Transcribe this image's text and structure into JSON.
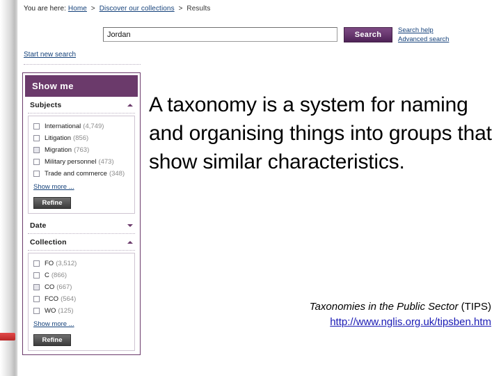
{
  "breadcrumb": {
    "prefix": "You are here:",
    "home": "Home",
    "separator": ">",
    "collections": "Discover our collections",
    "current": "Results"
  },
  "search": {
    "value": "Jordan",
    "placeholder": "",
    "button_label": "Search",
    "help_label": "Search help",
    "advanced_label": "Advanced search",
    "start_new_label": "Start new search"
  },
  "facets": {
    "header": "Show me",
    "subjects": {
      "title": "Subjects",
      "items": [
        {
          "label": "International",
          "count": "(4,749)"
        },
        {
          "label": "Litigation",
          "count": "(856)"
        },
        {
          "label": "Migration",
          "count": "(763)"
        },
        {
          "label": "Military personnel",
          "count": "(473)"
        },
        {
          "label": "Trade and commerce",
          "count": "(348)"
        }
      ],
      "show_more": "Show more ...",
      "refine": "Refine"
    },
    "date": {
      "title": "Date"
    },
    "collection": {
      "title": "Collection",
      "items": [
        {
          "label": "FO",
          "count": "(3,512)"
        },
        {
          "label": "C",
          "count": "(866)"
        },
        {
          "label": "CO",
          "count": "(667)"
        },
        {
          "label": "FCO",
          "count": "(564)"
        },
        {
          "label": "WO",
          "count": "(125)"
        }
      ],
      "show_more": "Show more ...",
      "refine": "Refine"
    }
  },
  "definition": "A taxonomy is a system for naming and organising things into groups that show similar characteristics.",
  "attribution": {
    "title": "Taxonomies in the Public Sector",
    "abbr": "(TIPS)",
    "url": "http://www.nglis.org.uk/tipsben.htm"
  },
  "colors": {
    "brand_purple": "#6b3a6b",
    "link_blue": "#14417a",
    "url_blue": "#1a1ab4",
    "refine_gray": "#555555",
    "red_tab": "#b92626"
  }
}
